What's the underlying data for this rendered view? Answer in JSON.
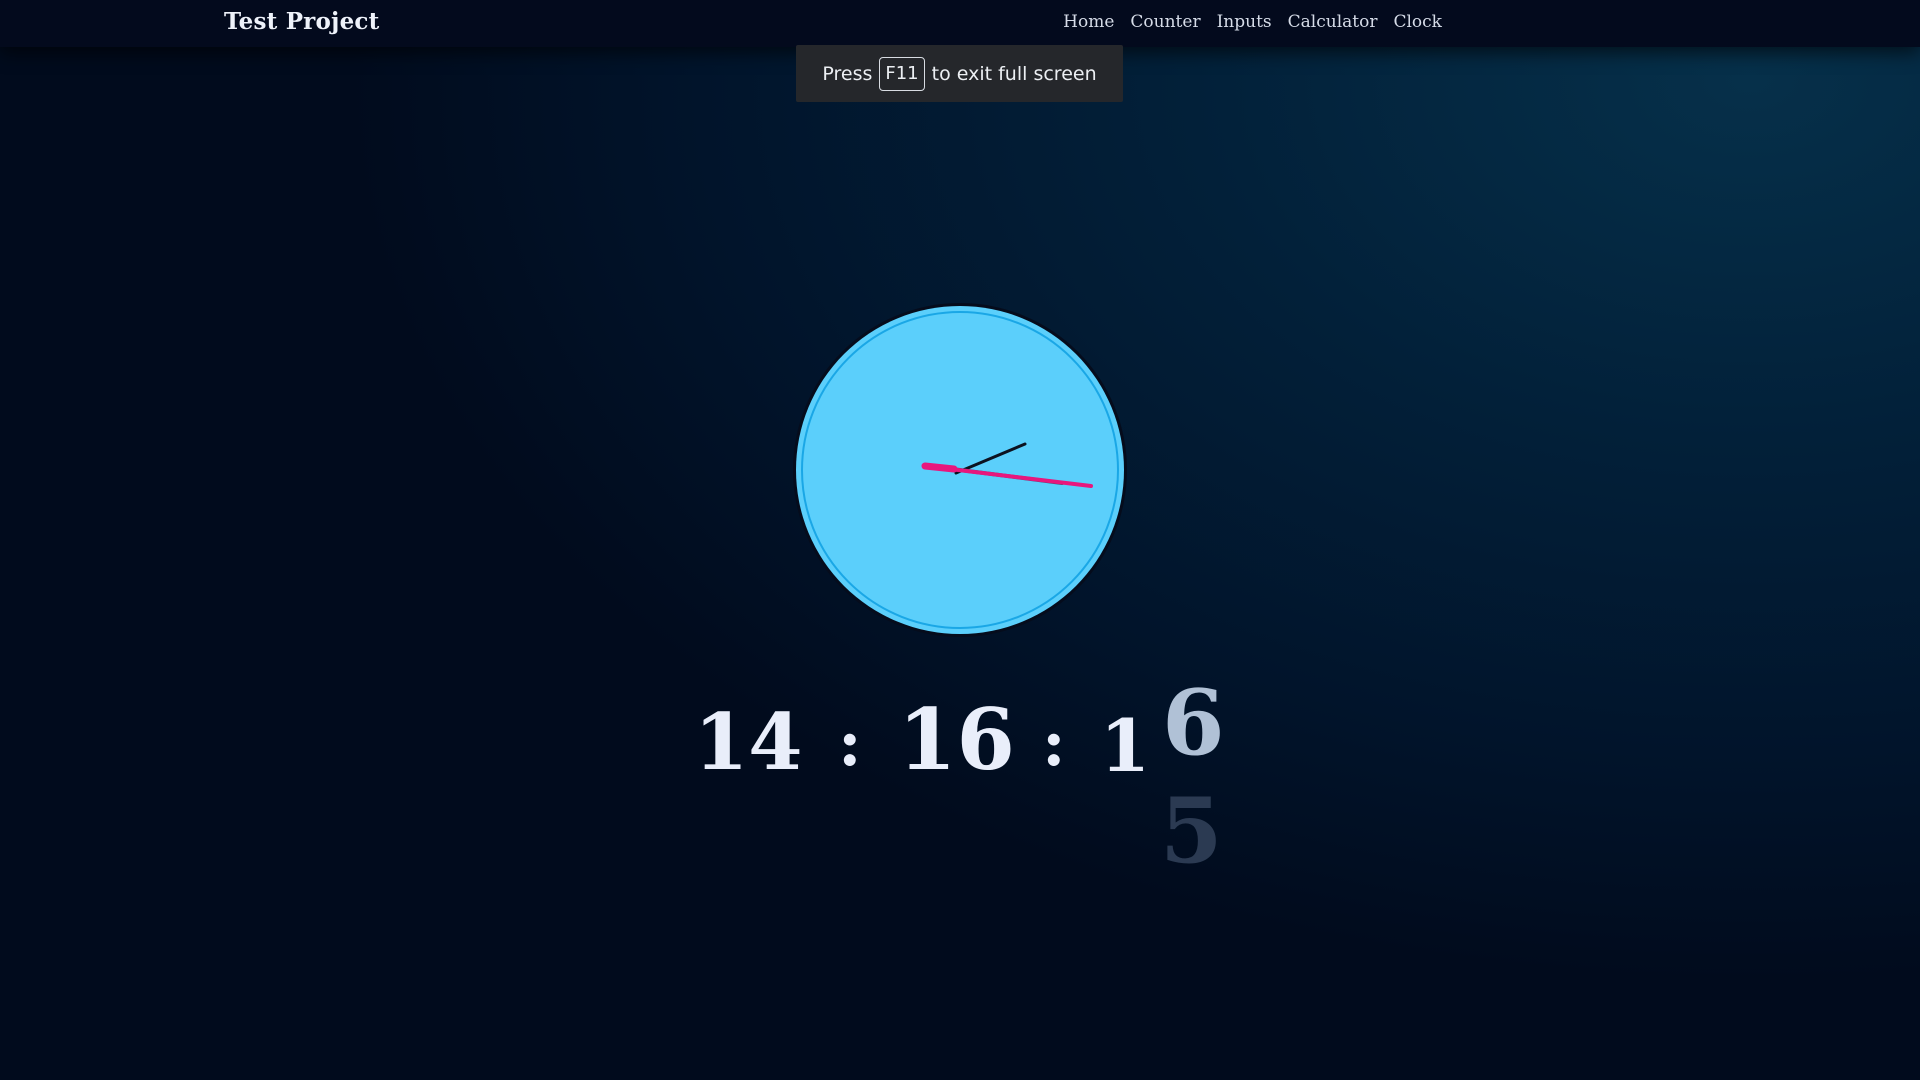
{
  "navbar": {
    "brand": "Test Project",
    "links": [
      "Home",
      "Counter",
      "Inputs",
      "Calculator",
      "Clock"
    ]
  },
  "fullscreen_toast": {
    "prefix": "Press",
    "key": "F11",
    "suffix": "to exit full screen"
  },
  "clock": {
    "hours": "14",
    "sep1": ":",
    "minutes": "16",
    "sep2": ":",
    "seconds_tens": "1",
    "seconds_ones_current": "6",
    "seconds_ones_next": "5",
    "face_color": "#5bcffb",
    "ring_color": "#1aa7e6",
    "second_hand_color": "#e8177d",
    "hand_color": "#0c1220"
  }
}
